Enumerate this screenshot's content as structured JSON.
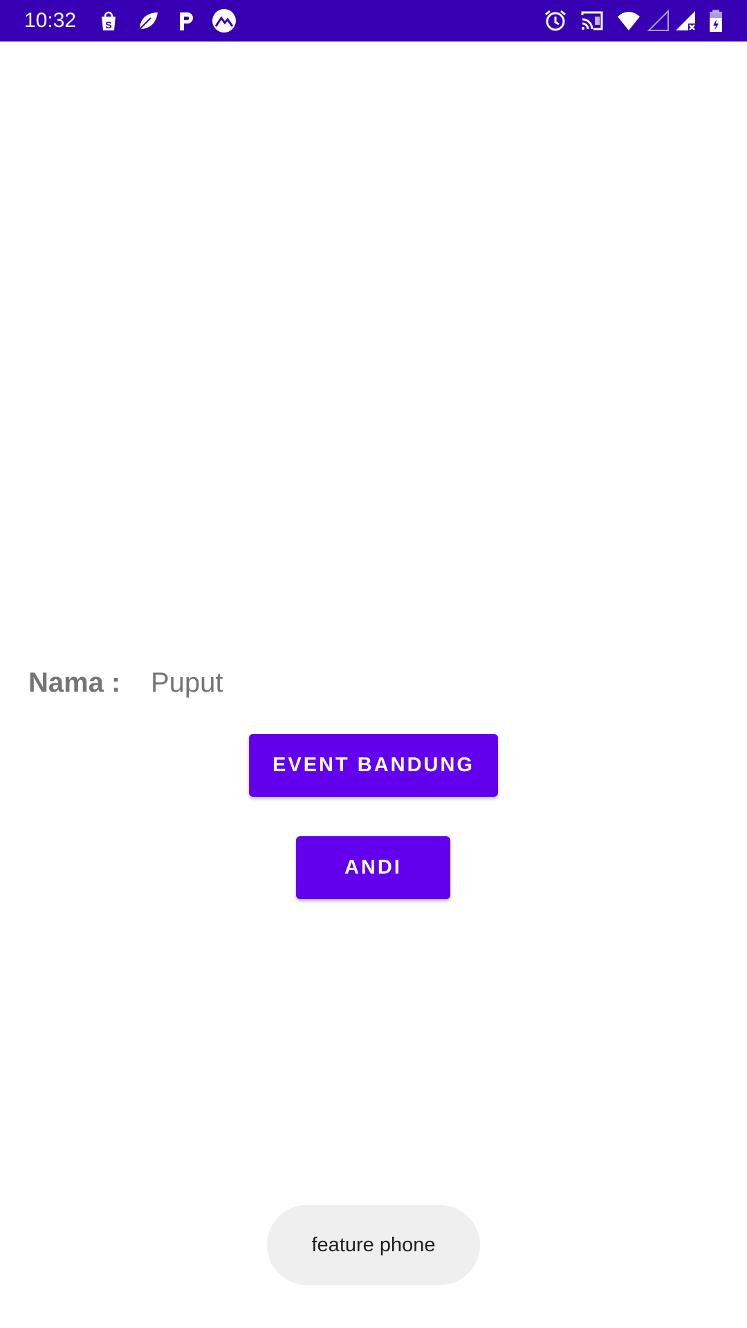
{
  "status_bar": {
    "time": "10:32",
    "background": "#3700b3",
    "left_icons": [
      "shopee-bag-icon",
      "leaf-app-icon",
      "paypal-p-icon",
      "mountain-app-icon"
    ],
    "right_icons": [
      "alarm-icon",
      "cast-icon",
      "wifi-icon",
      "signal-empty-icon",
      "signal-no-data-icon",
      "battery-charging-icon"
    ]
  },
  "form": {
    "name_label": "Nama :",
    "name_value": "Puput"
  },
  "buttons": {
    "event_label": "EVENT BANDUNG",
    "andi_label": "ANDI",
    "color": "#6200ee"
  },
  "toast": {
    "message": "feature phone"
  }
}
